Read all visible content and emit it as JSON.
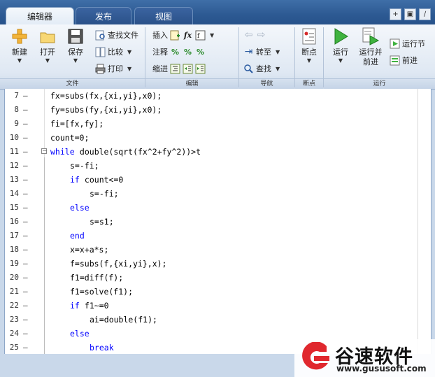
{
  "tabs": [
    {
      "label": "编辑器",
      "active": true
    },
    {
      "label": "发布",
      "active": false
    },
    {
      "label": "视图",
      "active": false
    }
  ],
  "ribbon": {
    "file": {
      "label": "文件",
      "new": "新建",
      "open": "打开",
      "save": "保存",
      "find_files": "查找文件",
      "compare": "比较",
      "print": "打印"
    },
    "edit": {
      "label": "编辑",
      "insert": "插入",
      "comment": "注释",
      "indent": "缩进",
      "fx": "fx"
    },
    "navigate": {
      "label": "导航",
      "goto": "转至",
      "find": "查找"
    },
    "breakpoints": {
      "label": "断点",
      "breakpoints": "断点"
    },
    "run": {
      "label": "运行",
      "run": "运行",
      "run_and_advance_1": "运行并",
      "run_and_advance_2": "前进",
      "run_section": "运行节",
      "advance": "前进"
    }
  },
  "editor": {
    "lines": [
      {
        "num": "7",
        "dash": "–",
        "code": "fx=subs(fx,{xi,yi},x0);"
      },
      {
        "num": "8",
        "dash": "–",
        "code": "fy=subs(fy,{xi,yi},x0);"
      },
      {
        "num": "9",
        "dash": "–",
        "code": "fi=[fx,fy];"
      },
      {
        "num": "10",
        "dash": "–",
        "code": "count=0;"
      },
      {
        "num": "11",
        "dash": "–",
        "kw": "while",
        "code": " double(sqrt(fx^2+fy^2))>t"
      },
      {
        "num": "12",
        "dash": "–",
        "code": "s=-fi;"
      },
      {
        "num": "13",
        "dash": "–",
        "kw": "if",
        "code": " count<=0"
      },
      {
        "num": "14",
        "dash": "–",
        "code": "s=-fi;"
      },
      {
        "num": "15",
        "dash": "–",
        "kw": "else",
        "code": ""
      },
      {
        "num": "16",
        "dash": "–",
        "code": "s=s1;"
      },
      {
        "num": "17",
        "dash": "–",
        "kw": "end",
        "code": ""
      },
      {
        "num": "18",
        "dash": "–",
        "code": "x=x+a*s;"
      },
      {
        "num": "19",
        "dash": "–",
        "code": "f=subs(f,{xi,yi},x);"
      },
      {
        "num": "20",
        "dash": "–",
        "code": "f1=diff(f);"
      },
      {
        "num": "21",
        "dash": "–",
        "code": "f1=solve(f1);"
      },
      {
        "num": "22",
        "dash": "–",
        "kw": "if",
        "code": " f1~=0"
      },
      {
        "num": "23",
        "dash": "–",
        "code": "ai=double(f1);"
      },
      {
        "num": "24",
        "dash": "–",
        "kw": "else",
        "code": ""
      },
      {
        "num": "25",
        "dash": "–",
        "kw": "break",
        "code": ""
      }
    ]
  },
  "watermark": {
    "name": "谷速软件",
    "url": "www.gususoft.com"
  },
  "colors": {
    "keyword": "#0000ff",
    "tabstrip": "#2d5a93",
    "logo_red": "#e0282e"
  }
}
